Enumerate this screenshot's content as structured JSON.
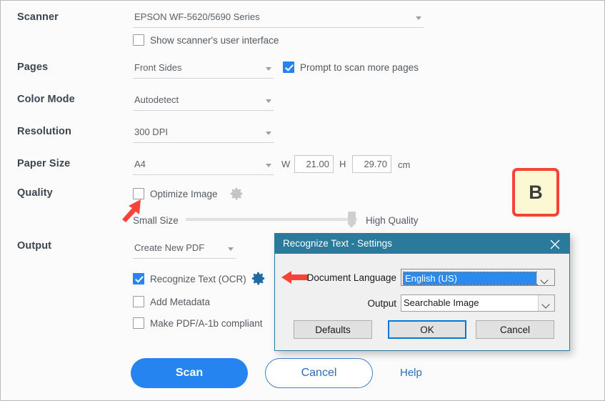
{
  "form": {
    "rows": [
      {
        "label": "Scanner"
      },
      {
        "label": "Pages"
      },
      {
        "label": "Color Mode"
      },
      {
        "label": "Resolution"
      },
      {
        "label": "Paper Size"
      },
      {
        "label": "Quality"
      },
      {
        "label": "Output"
      }
    ],
    "scanner": {
      "value": "EPSON WF-5620/5690 Series",
      "show_ui_label": "Show scanner's user interface",
      "show_ui_checked": false
    },
    "pages": {
      "value": "Front Sides",
      "prompt_label": "Prompt to scan more pages",
      "prompt_checked": true
    },
    "color_mode": {
      "value": "Autodetect"
    },
    "resolution": {
      "value": "300 DPI"
    },
    "paper_size": {
      "value": "A4",
      "w_label": "W",
      "w_value": "21.00",
      "h_label": "H",
      "h_value": "29.70",
      "unit": "cm"
    },
    "quality": {
      "optimize_label": "Optimize Image",
      "optimize_checked": false,
      "slider_min_label": "Small Size",
      "slider_max_label": "High Quality",
      "slider_percent": 95
    },
    "output": {
      "value": "Create New PDF",
      "options": [
        {
          "label": "Recognize Text (OCR)",
          "checked": true,
          "has_gear": true
        },
        {
          "label": "Add Metadata",
          "checked": false,
          "has_gear": false
        },
        {
          "label": "Make PDF/A-1b compliant",
          "checked": false,
          "has_gear": false
        }
      ]
    }
  },
  "footer": {
    "scan_label": "Scan",
    "cancel_label": "Cancel",
    "help_label": "Help"
  },
  "annotation": {
    "badge_label": "B"
  },
  "dialog": {
    "title": "Recognize Text - Settings",
    "document_language_label": "Document Language",
    "document_language_value": "English (US)",
    "output_label": "Output",
    "output_value": "Searchable Image",
    "defaults_label": "Defaults",
    "ok_label": "OK",
    "cancel_label": "Cancel"
  },
  "colors": {
    "accent_blue": "#2684f0",
    "dialog_titlebar": "#2a7b9b",
    "annotation_red": "#f9423a",
    "badge_fill": "#fdf8d4",
    "label_text": "#3c4550"
  }
}
